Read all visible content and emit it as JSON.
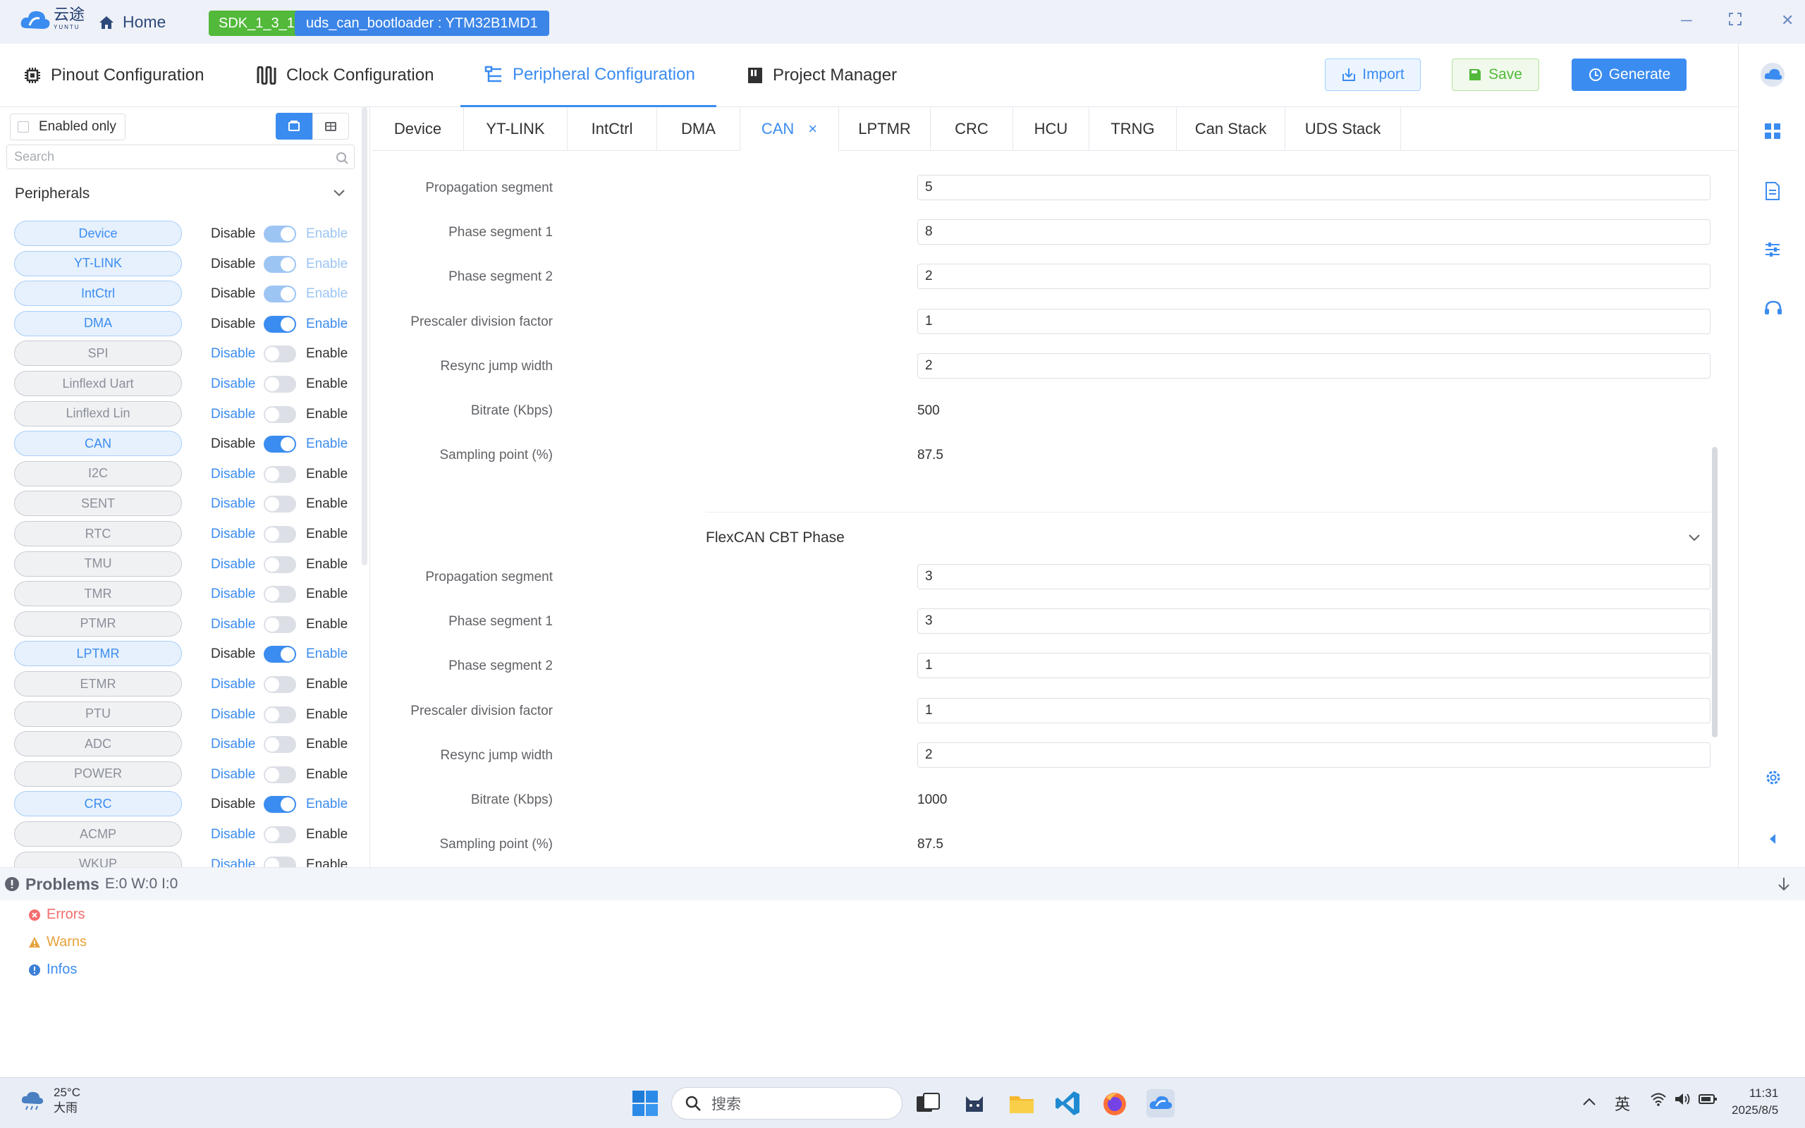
{
  "titlebar": {
    "logo_text": "云途",
    "logo_sub": "YUNTU",
    "home": "Home",
    "sdk": "SDK_1_3_1",
    "project": "uds_can_bootloader : YTM32B1MD1"
  },
  "nav": {
    "tabs": [
      "Pinout Configuration",
      "Clock Configuration",
      "Peripheral Configuration",
      "Project Manager"
    ],
    "active": "Peripheral Configuration",
    "import": "Import",
    "save": "Save",
    "generate": "Generate"
  },
  "sidebar": {
    "enabled_only": "Enabled only",
    "search_placeholder": "Search",
    "peripherals_title": "Peripherals",
    "disable_label": "Disable",
    "enable_label": "Enable",
    "items": [
      {
        "name": "Device",
        "state": "locked"
      },
      {
        "name": "YT-LINK",
        "state": "locked"
      },
      {
        "name": "IntCtrl",
        "state": "locked"
      },
      {
        "name": "DMA",
        "state": "on"
      },
      {
        "name": "SPI",
        "state": "off"
      },
      {
        "name": "Linflexd Uart",
        "state": "off"
      },
      {
        "name": "Linflexd Lin",
        "state": "off"
      },
      {
        "name": "CAN",
        "state": "on"
      },
      {
        "name": "I2C",
        "state": "off"
      },
      {
        "name": "SENT",
        "state": "off"
      },
      {
        "name": "RTC",
        "state": "off"
      },
      {
        "name": "TMU",
        "state": "off"
      },
      {
        "name": "TMR",
        "state": "off"
      },
      {
        "name": "PTMR",
        "state": "off"
      },
      {
        "name": "LPTMR",
        "state": "on"
      },
      {
        "name": "ETMR",
        "state": "off"
      },
      {
        "name": "PTU",
        "state": "off"
      },
      {
        "name": "ADC",
        "state": "off"
      },
      {
        "name": "POWER",
        "state": "off"
      },
      {
        "name": "CRC",
        "state": "on"
      },
      {
        "name": "ACMP",
        "state": "off"
      },
      {
        "name": "WKUP",
        "state": "off"
      }
    ]
  },
  "periph_tabs": {
    "items": [
      "Device",
      "YT-LINK",
      "IntCtrl",
      "DMA",
      "CAN",
      "LPTMR",
      "CRC",
      "HCU",
      "TRNG",
      "Can Stack",
      "UDS Stack"
    ],
    "active": "CAN",
    "close": "×"
  },
  "config": {
    "section1": [
      {
        "label": "Propagation segment",
        "value": "5",
        "type": "input"
      },
      {
        "label": "Phase segment 1",
        "value": "8",
        "type": "input"
      },
      {
        "label": "Phase segment 2",
        "value": "2",
        "type": "input"
      },
      {
        "label": "Prescaler division factor",
        "value": "1",
        "type": "input"
      },
      {
        "label": "Resync jump width",
        "value": "2",
        "type": "input"
      },
      {
        "label": "Bitrate (Kbps)",
        "value": "500",
        "type": "text"
      },
      {
        "label": "Sampling point (%)",
        "value": "87.5",
        "type": "text"
      }
    ],
    "section2_title": "FlexCAN CBT Phase",
    "section2": [
      {
        "label": "Propagation segment",
        "value": "3",
        "type": "input"
      },
      {
        "label": "Phase segment 1",
        "value": "3",
        "type": "input"
      },
      {
        "label": "Phase segment 2",
        "value": "1",
        "type": "input"
      },
      {
        "label": "Prescaler division factor",
        "value": "1",
        "type": "input"
      },
      {
        "label": "Resync jump width",
        "value": "2",
        "type": "input"
      },
      {
        "label": "Bitrate (Kbps)",
        "value": "1000",
        "type": "text"
      },
      {
        "label": "Sampling point (%)",
        "value": "87.5",
        "type": "text"
      }
    ]
  },
  "problems": {
    "title": "Problems",
    "counts": "E:0 W:0 I:0",
    "errors": "Errors",
    "warns": "Warns",
    "infos": "Infos"
  },
  "taskbar": {
    "temp": "25°C",
    "weather": "大雨",
    "search": "搜索",
    "ime": "英",
    "time": "11:31",
    "date": "2025/8/5"
  },
  "colors": {
    "accent": "#3b8cf0",
    "sdk_green": "#52b93a",
    "save_green": "#52b93a",
    "error": "#f56c6c",
    "warn": "#e6a23c"
  }
}
